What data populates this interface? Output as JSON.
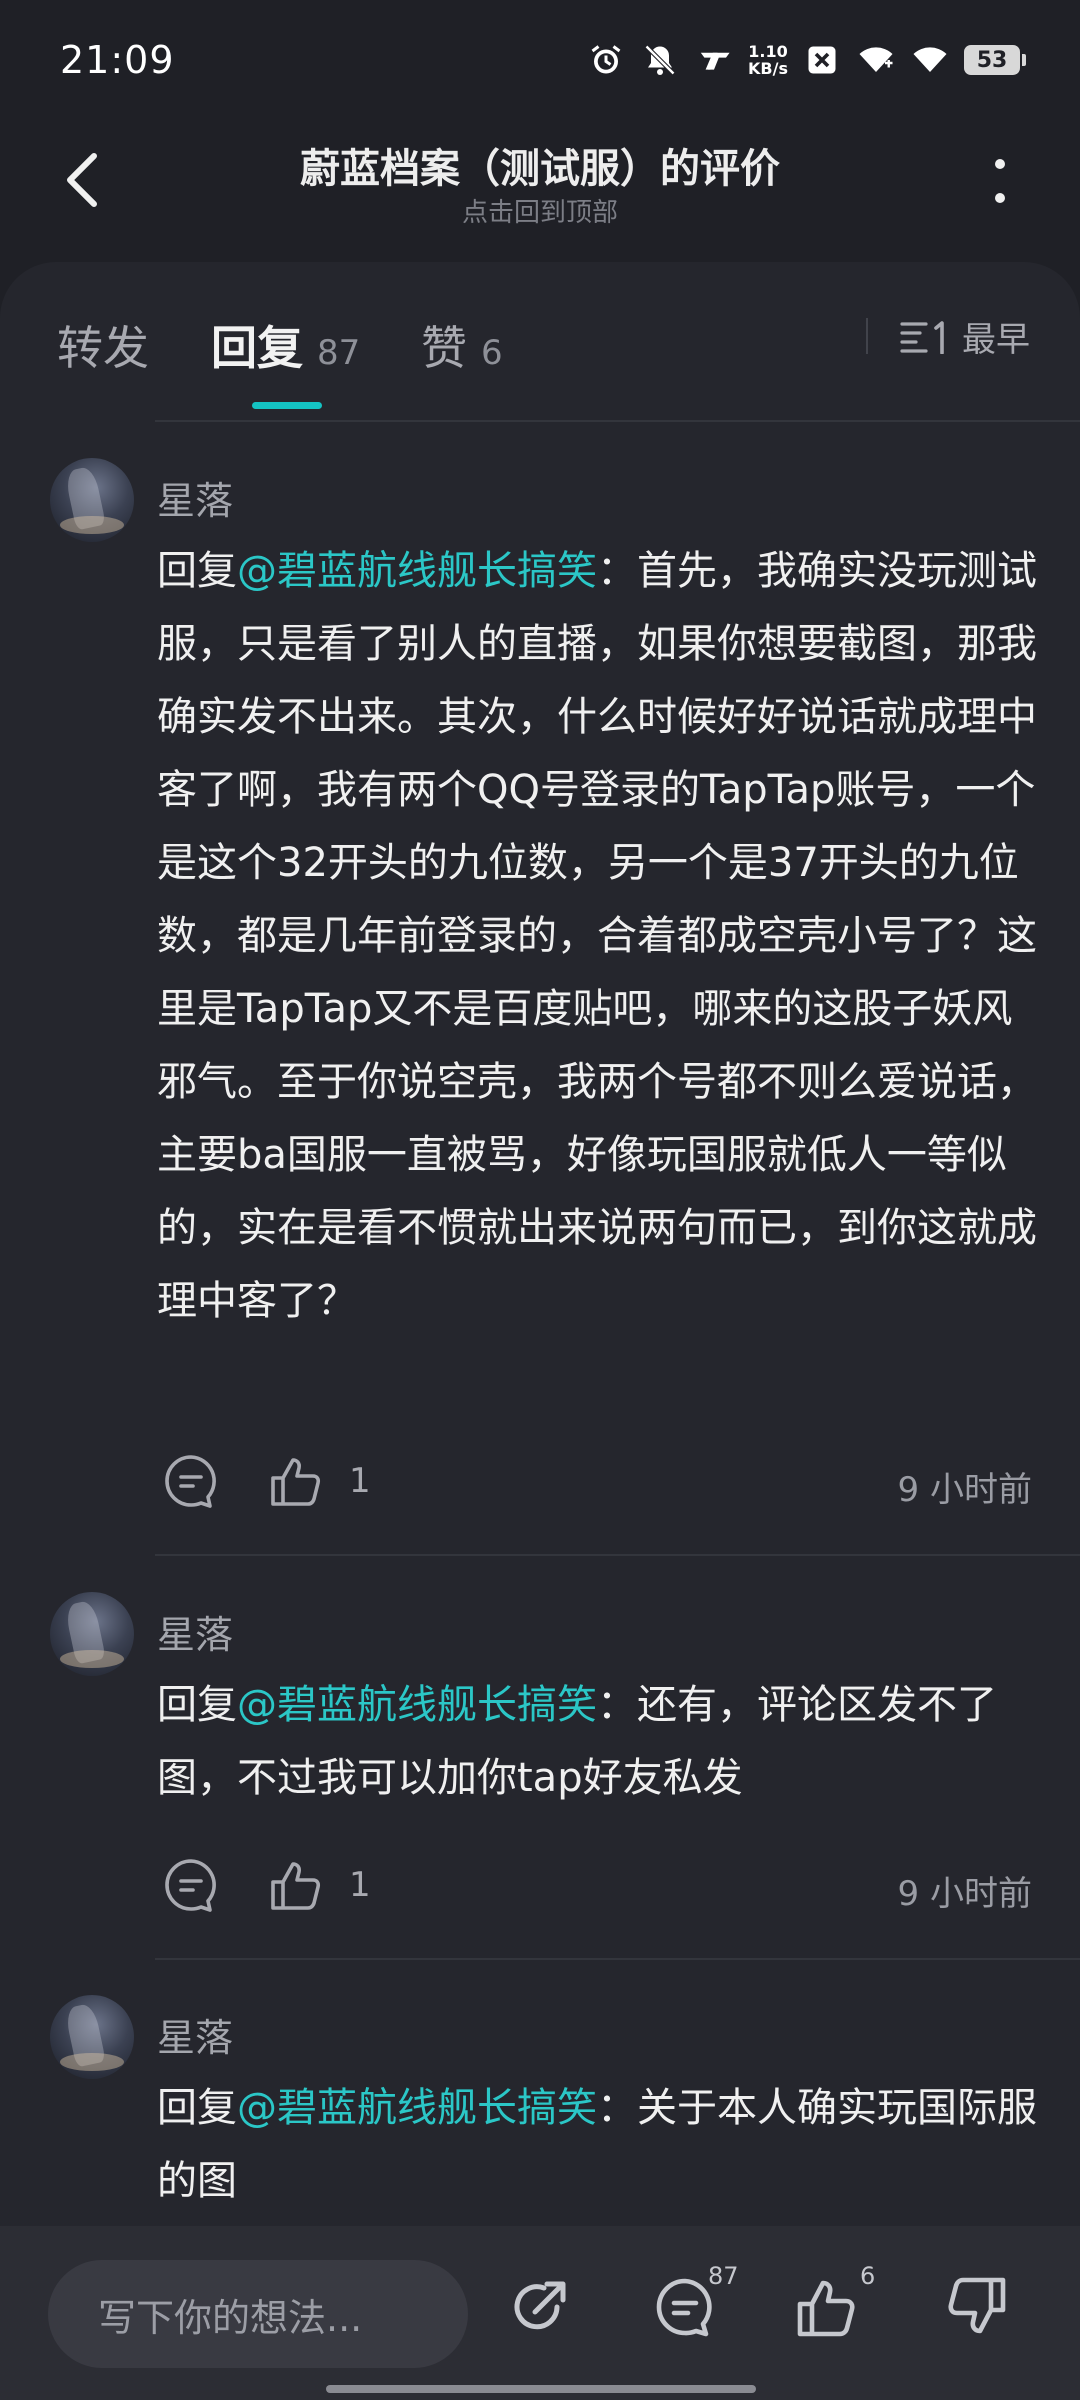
{
  "status_bar": {
    "time": "21:09",
    "net_speed_value": "1.10",
    "net_speed_unit": "KB/s",
    "battery": "53",
    "icons": [
      "alarm-icon",
      "mute-icon",
      "signal-brand-icon",
      "speed-icon",
      "close-box-icon",
      "wifi-icon",
      "wifi-icon",
      "battery-icon"
    ]
  },
  "header": {
    "title": "蔚蓝档案（测试服）的评价",
    "subtitle": "点击回到顶部"
  },
  "tabs": [
    {
      "label": "转发",
      "count": ""
    },
    {
      "label": "回复",
      "count": "87"
    },
    {
      "label": "赞",
      "count": "6"
    }
  ],
  "active_tab": 1,
  "sort": {
    "label": "最早",
    "icon": "sort-icon"
  },
  "comments": [
    {
      "user": "星落",
      "reply_prefix": "回复",
      "mention": "@碧蓝航线舰长搞笑",
      "text": "：首先，我确实没玩测试服，只是看了别人的直播，如果你想要截图，那我确实发不出来。其次，什么时候好好说话就成理中客了啊，我有两个QQ号登录的TapTap账号，一个是这个32开头的九位数，另一个是37开头的九位数，都是几年前登录的，合着都成空壳小号了？这里是TapTap又不是百度贴吧，哪来的这股子妖风邪气。至于你说空壳，我两个号都不则么爱说话，主要ba国服一直被骂，好像玩国服就低人一等似的，实在是看不惯就出来说两句而已，到你这就成理中客了？",
      "likes": "1",
      "time": "9 小时前"
    },
    {
      "user": "星落",
      "reply_prefix": "回复",
      "mention": "@碧蓝航线舰长搞笑",
      "text": "：还有，评论区发不了图，不过我可以加你tap好友私发",
      "likes": "1",
      "time": "9 小时前"
    },
    {
      "user": "星落",
      "reply_prefix": "回复",
      "mention": "@碧蓝航线舰长搞笑",
      "text": "：关于本人确实玩国际服的图"
    }
  ],
  "bottom_bar": {
    "input_placeholder": "写下你的想法...",
    "reply_count": "87",
    "like_count": "6"
  },
  "colors": {
    "background": "#1f2026",
    "panel": "#25262d",
    "accent": "#14c3c3",
    "mention": "#2bc7c7"
  }
}
